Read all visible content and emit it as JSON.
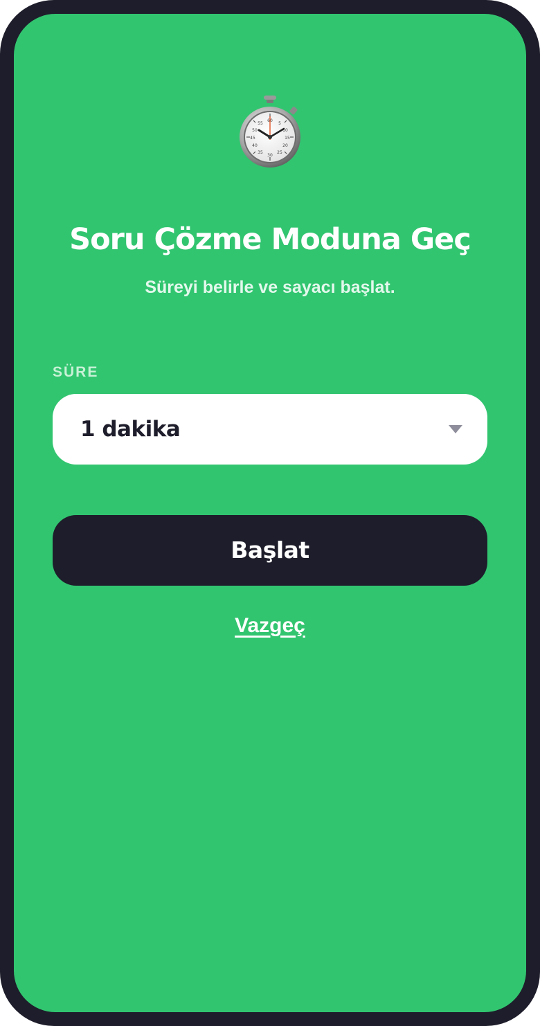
{
  "header": {
    "icon": "stopwatch-icon",
    "title": "Soru Çözme Moduna Geç",
    "subtitle": "Süreyi belirle ve sayacı başlat."
  },
  "form": {
    "duration_label": "SÜRE",
    "duration_selected": "1 dakika",
    "dropdown_icon": "chevron-down-icon"
  },
  "actions": {
    "start_label": "Başlat",
    "cancel_label": "Vazgeç"
  },
  "colors": {
    "background": "#32c570",
    "frame": "#1e1d2b",
    "button": "#1e1d2b",
    "text": "#ffffff"
  }
}
